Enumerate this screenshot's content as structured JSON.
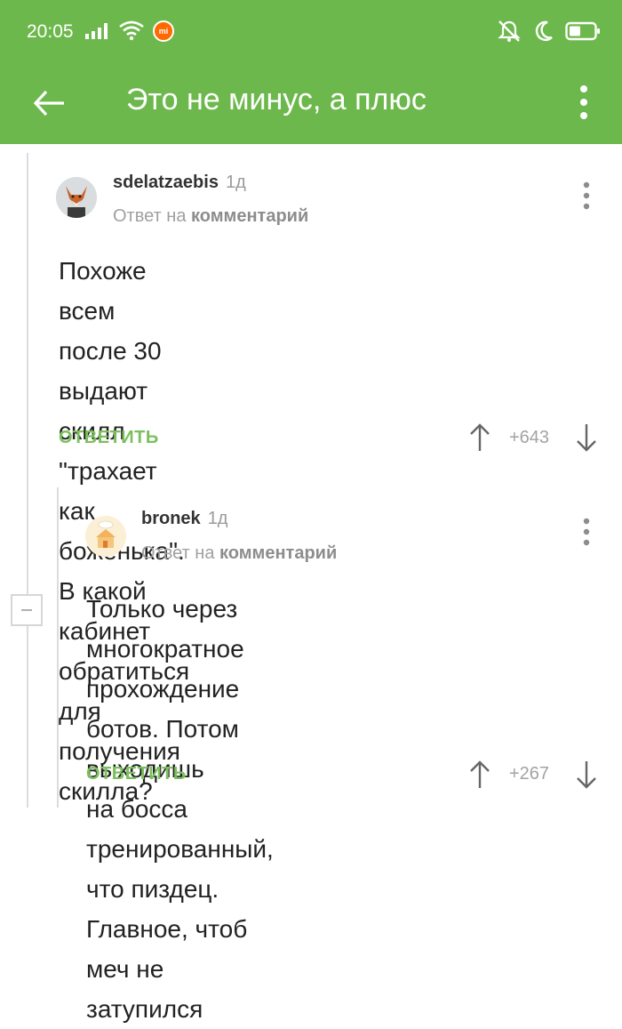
{
  "status_bar": {
    "time": "20:05",
    "mi_badge": "mi"
  },
  "app_bar": {
    "title": "Это не минус, а плюс"
  },
  "comments": [
    {
      "username": "sdelatzaebis",
      "age": "1д",
      "reply_prefix": "Ответ на",
      "reply_target": "комментарий",
      "body_lines": [
        "Похоже всем после 30 выдают скилл",
        "\"трахает как боженька\".",
        "В какой кабинет обратиться для",
        "получения скилла?"
      ],
      "reply_label": "ОТВЕТИТЬ",
      "score": "+643"
    },
    {
      "username": "bronek",
      "age": "1д",
      "reply_prefix": "Ответ на",
      "reply_target": "комментарий",
      "body_lines": [
        "Только через многократное",
        "прохождение ботов. Потом выходишь",
        "на босса тренированный, что пиздец.",
        "Главное, чтоб меч не затупился"
      ],
      "reply_label": "ОТВЕТИТЬ",
      "score": "+267"
    }
  ],
  "colors": {
    "brand_green": "#6db84c",
    "reply_green": "#7cc05e"
  },
  "icons": [
    "signal-icon",
    "wifi-icon",
    "mute-vibrate-icon",
    "moon-icon",
    "battery-icon",
    "back-arrow-icon",
    "more-vert-icon",
    "arrow-up-icon",
    "arrow-down-icon",
    "collapse-minus-icon"
  ]
}
